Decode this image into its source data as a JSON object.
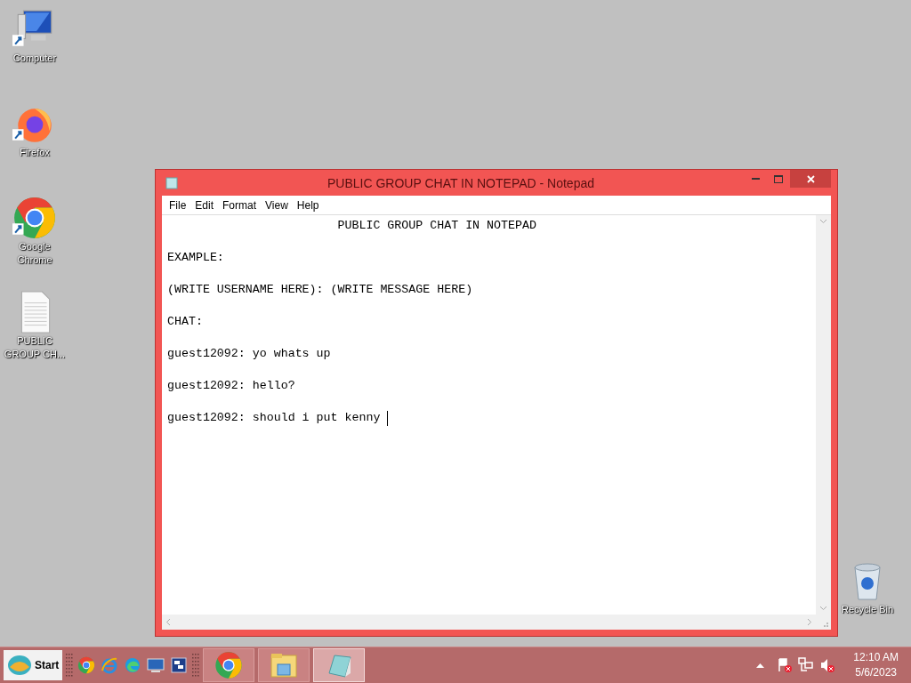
{
  "desktop": {
    "icons": [
      {
        "kind": "computer",
        "label": "Computer",
        "shortcut": true
      },
      {
        "kind": "firefox",
        "label": "Firefox",
        "shortcut": true
      },
      {
        "kind": "chrome",
        "label": "Google Chrome",
        "shortcut": true
      },
      {
        "kind": "document",
        "label": "PUBLIC GROUP CH...",
        "shortcut": false
      }
    ],
    "corner_icon": {
      "kind": "recycle",
      "label": "Recycle Bin"
    }
  },
  "window": {
    "title": "PUBLIC GROUP CHAT IN NOTEPAD - Notepad",
    "active": true,
    "menu": [
      "File",
      "Edit",
      "Format",
      "View",
      "Help"
    ],
    "lines": [
      "                        PUBLIC GROUP CHAT IN NOTEPAD",
      "EXAMPLE:",
      "(WRITE USERNAME HERE): (WRITE MESSAGE HERE)",
      "CHAT:",
      "guest12092: yo whats up",
      "guest12092: hello?",
      "guest12092: should i put kenny "
    ]
  },
  "taskbar": {
    "start": "Start",
    "quick_launch": [
      {
        "kind": "chrome"
      },
      {
        "kind": "ie"
      },
      {
        "kind": "edge"
      },
      {
        "kind": "desktop"
      },
      {
        "kind": "switcher"
      }
    ],
    "tasks": [
      {
        "kind": "chrome",
        "selected": false
      },
      {
        "kind": "explorer",
        "selected": false
      },
      {
        "kind": "notepad",
        "selected": true
      }
    ],
    "tray": [
      {
        "kind": "flag"
      },
      {
        "kind": "network"
      },
      {
        "kind": "speaker"
      }
    ],
    "time": "12:10 AM",
    "date": "5/6/2023"
  }
}
